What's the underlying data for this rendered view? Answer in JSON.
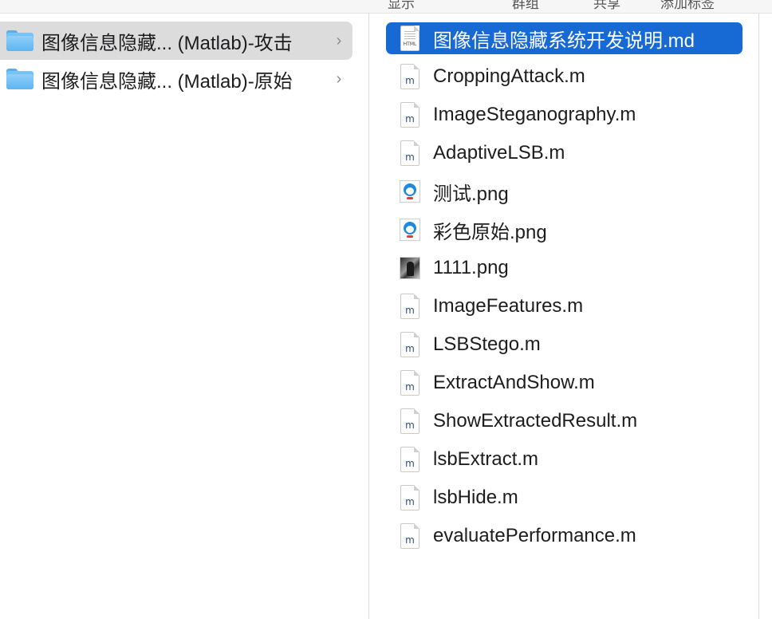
{
  "toolbar": {
    "labels": [
      "显示",
      "群组",
      "共享",
      "添加标签"
    ]
  },
  "left_column": {
    "folders": [
      {
        "label": "图像信息隐藏... (Matlab)-攻击",
        "icon": "folder-icon",
        "selected": true,
        "chevron": "›"
      },
      {
        "label": "图像信息隐藏... (Matlab)-原始",
        "icon": "folder-icon",
        "selected": false,
        "chevron": "›"
      }
    ]
  },
  "right_column": {
    "files": [
      {
        "label": "图像信息隐藏系统开发说明.md",
        "icon": "html-document-icon",
        "ext": "HTML",
        "selected": true
      },
      {
        "label": "CroppingAttack.m",
        "icon": "matlab-file-icon",
        "ext": "m"
      },
      {
        "label": "ImageSteganography.m",
        "icon": "matlab-file-icon",
        "ext": "m"
      },
      {
        "label": "AdaptiveLSB.m",
        "icon": "matlab-file-icon",
        "ext": "m"
      },
      {
        "label": "测试.png",
        "icon": "image-thumbnail-icon",
        "ext": ""
      },
      {
        "label": "彩色原始.png",
        "icon": "image-thumbnail-icon",
        "ext": ""
      },
      {
        "label": "1111.png",
        "icon": "photo-thumbnail-icon",
        "ext": ""
      },
      {
        "label": "ImageFeatures.m",
        "icon": "matlab-file-icon",
        "ext": "m"
      },
      {
        "label": "LSBStego.m",
        "icon": "matlab-file-icon",
        "ext": "m"
      },
      {
        "label": "ExtractAndShow.m",
        "icon": "matlab-file-icon",
        "ext": "m"
      },
      {
        "label": "ShowExtractedResult.m",
        "icon": "matlab-file-icon",
        "ext": "m"
      },
      {
        "label": "lsbExtract.m",
        "icon": "matlab-file-icon",
        "ext": "m"
      },
      {
        "label": "lsbHide.m",
        "icon": "matlab-file-icon",
        "ext": "m"
      },
      {
        "label": "evaluatePerformance.m",
        "icon": "matlab-file-icon",
        "ext": "m"
      }
    ]
  },
  "colors": {
    "selection_blue": "#1769d4",
    "inactive_selection_gray": "#dcdcdc",
    "folder_blue": "#5db4f0"
  }
}
